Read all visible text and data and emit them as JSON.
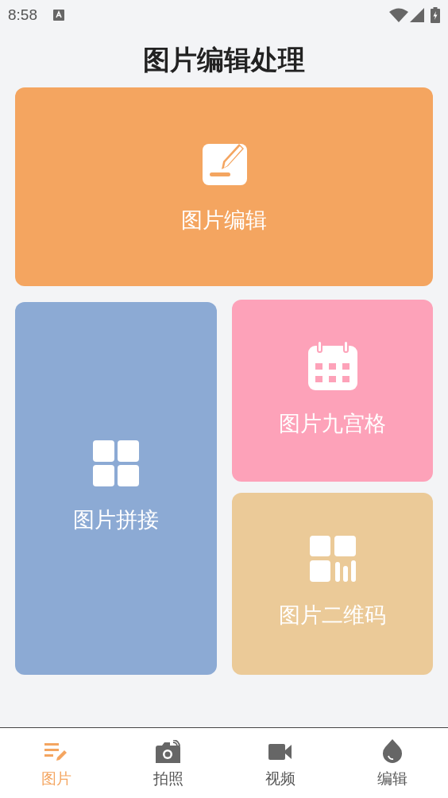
{
  "status_bar": {
    "time": "8:58"
  },
  "title": "图片编辑处理",
  "cards": [
    {
      "kind": "edit",
      "label": "图片编辑",
      "color": "#f4a560"
    },
    {
      "kind": "collage",
      "label": "图片拼接",
      "color": "#8caad4"
    },
    {
      "kind": "grid",
      "label": "图片九宫格",
      "color": "#fda2b9"
    },
    {
      "kind": "qrcode",
      "label": "图片二维码",
      "color": "#ebca98"
    }
  ],
  "tabs": [
    {
      "kind": "image",
      "label": "图片",
      "selected": true
    },
    {
      "kind": "camera",
      "label": "拍照",
      "selected": false
    },
    {
      "kind": "video",
      "label": "视频",
      "selected": false
    },
    {
      "kind": "drop",
      "label": "编辑",
      "selected": false
    }
  ]
}
